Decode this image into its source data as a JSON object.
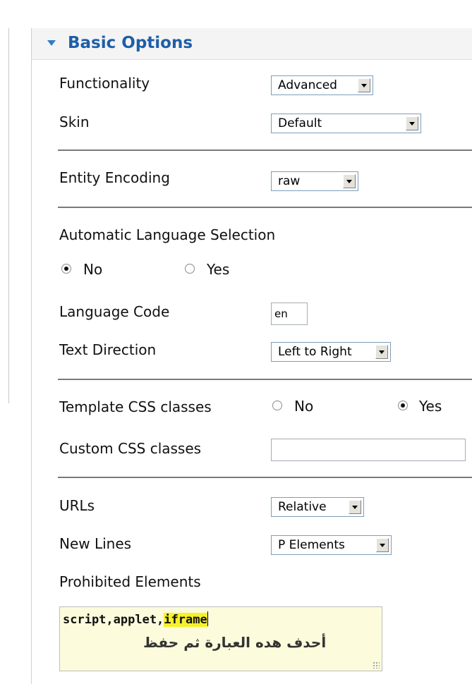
{
  "panel": {
    "title": "Basic Options"
  },
  "fields": {
    "functionality": {
      "label": "Functionality",
      "value": "Advanced"
    },
    "skin": {
      "label": "Skin",
      "value": "Default"
    },
    "entity_encoding": {
      "label": "Entity Encoding",
      "value": "raw"
    },
    "auto_language": {
      "label": "Automatic Language Selection",
      "options": [
        "No",
        "Yes"
      ],
      "selected": "No"
    },
    "language_code": {
      "label": "Language Code",
      "value": "en"
    },
    "text_direction": {
      "label": "Text Direction",
      "value": "Left to Right"
    },
    "template_css": {
      "label": "Template CSS classes",
      "options": [
        "No",
        "Yes"
      ],
      "selected": "Yes"
    },
    "custom_css": {
      "label": "Custom CSS classes",
      "value": ""
    },
    "urls": {
      "label": "URLs",
      "value": "Relative"
    },
    "new_lines": {
      "label": "New Lines",
      "value": "P Elements"
    },
    "prohibited_elements": {
      "label": "Prohibited Elements",
      "value_plain": "script,applet,",
      "value_highlight": "iframe",
      "note": "أحدف هده العبارة ثم حفظ"
    }
  },
  "colors": {
    "title": "#1d5fa8",
    "arrow": "#2a7fc8",
    "textarea_bg": "#fcfbdc",
    "highlight": "#f5f12a"
  },
  "icons": {
    "section_toggle": "triangle-down-icon",
    "dropdown": "chevron-down-icon",
    "resize": "resize-grip-icon"
  }
}
